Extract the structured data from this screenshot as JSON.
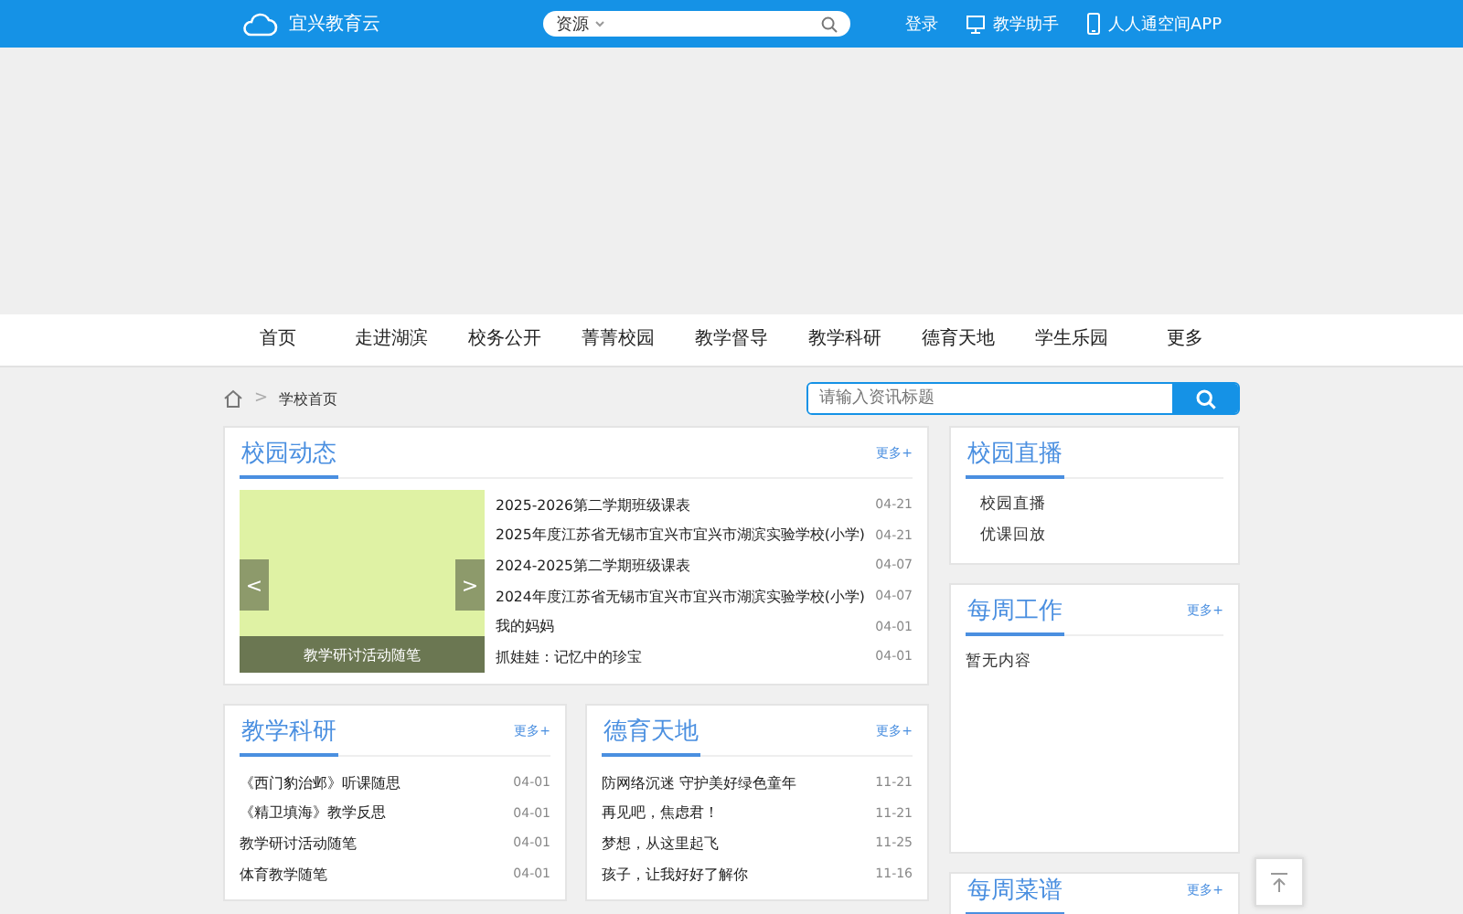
{
  "header": {
    "site_name": "宜兴教育云",
    "search": {
      "scope": "资源"
    },
    "links": [
      {
        "kind": "text",
        "label": "登录"
      },
      {
        "kind": "monitor",
        "label": "教学助手"
      },
      {
        "kind": "phone",
        "label": "人人通空间APP"
      }
    ]
  },
  "nav": {
    "items": [
      {
        "label": "首页",
        "selected": false
      },
      {
        "label": "走进湖滨",
        "selected": false
      },
      {
        "label": "校务公开",
        "selected": false
      },
      {
        "label": "菁菁校园",
        "selected": false
      },
      {
        "label": "教学督导",
        "selected": false
      },
      {
        "label": "教学科研",
        "selected": false
      },
      {
        "label": "德育天地",
        "selected": false
      },
      {
        "label": "学生乐园",
        "selected": false
      },
      {
        "label": "更多",
        "selected": false
      }
    ]
  },
  "breadcrumb": {
    "separator": ">",
    "current": "学校首页"
  },
  "news_search": {
    "placeholder": "请输入资讯标题"
  },
  "campus_news": {
    "title": "校园动态",
    "more": "更多+",
    "carousel": {
      "prev": "<",
      "next": ">",
      "caption": "教学研讨活动随笔"
    },
    "items": [
      {
        "title": "2025-2026第二学期班级课表",
        "date": "04-21"
      },
      {
        "title": "2025年度江苏省无锡市宜兴市宜兴市湖滨实验学校(小学)",
        "date": "04-21"
      },
      {
        "title": "2024-2025第二学期班级课表",
        "date": "04-07"
      },
      {
        "title": "2024年度江苏省无锡市宜兴市宜兴市湖滨实验学校(小学)",
        "date": "04-07"
      },
      {
        "title": "我的妈妈",
        "date": "04-01"
      },
      {
        "title": "抓娃娃：记忆中的珍宝",
        "date": "04-01"
      }
    ]
  },
  "research": {
    "title": "教学科研",
    "more": "更多+",
    "items": [
      {
        "title": "《西门豹治邺》听课随思",
        "date": "04-01"
      },
      {
        "title": "《精卫填海》教学反思",
        "date": "04-01"
      },
      {
        "title": "教学研讨活动随笔",
        "date": "04-01"
      },
      {
        "title": "体育教学随笔",
        "date": "04-01"
      }
    ]
  },
  "moral": {
    "title": "德育天地",
    "more": "更多+",
    "items": [
      {
        "title": "防网络沉迷 守护美好绿色童年",
        "date": "11-21"
      },
      {
        "title": "再见吧，焦虑君！",
        "date": "11-21"
      },
      {
        "title": "梦想，从这里起飞",
        "date": "11-25"
      },
      {
        "title": "孩子，让我好好了解你",
        "date": "11-16"
      }
    ]
  },
  "live": {
    "title": "校园直播",
    "items": [
      "校园直播",
      "优课回放"
    ]
  },
  "weekly_work": {
    "title": "每周工作",
    "more": "更多+",
    "empty": "暂无内容"
  },
  "weekly_menu": {
    "title": "每周菜谱",
    "more": "更多+"
  }
}
